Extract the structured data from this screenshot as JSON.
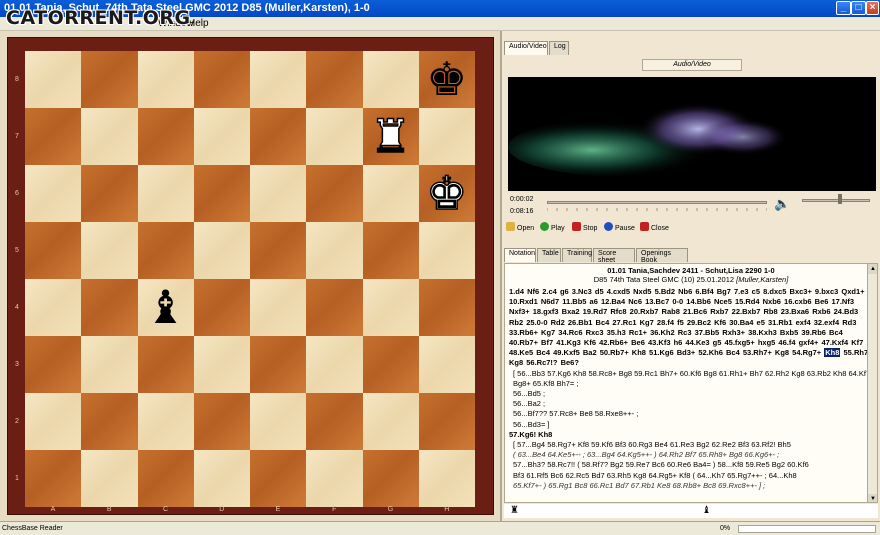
{
  "window": {
    "title": "01.01 Tania,  Schut, 74th Tata Steel GMC 2012  D85  (Muller,Karsten), 1-0",
    "logo": "CATORRENT.ORG",
    "menu": [
      "Window",
      "Help"
    ]
  },
  "board": {
    "ranks": [
      "8",
      "7",
      "6",
      "5",
      "4",
      "3",
      "2",
      "1"
    ],
    "files": [
      "A",
      "B",
      "C",
      "D",
      "E",
      "F",
      "G",
      "H"
    ],
    "pieces": [
      {
        "square": "h8",
        "glyph": "♚",
        "color": "black",
        "name": "black-king"
      },
      {
        "square": "g7",
        "glyph": "♜",
        "color": "white",
        "name": "white-rook"
      },
      {
        "square": "h6",
        "glyph": "♚",
        "color": "white",
        "name": "white-king"
      },
      {
        "square": "c4",
        "glyph": "♝",
        "color": "black",
        "name": "black-bishop"
      }
    ]
  },
  "panel_tabs": {
    "top": [
      "Audio/Video",
      "Log"
    ],
    "bottom": [
      "Notation",
      "Table",
      "Training",
      "Score sheet",
      "Openings Book"
    ]
  },
  "media": {
    "title": "Audio/Video",
    "elapsed": "0:00:02",
    "total": "0:08:16",
    "buttons": [
      "Open",
      "Play",
      "Stop",
      "Pause",
      "Close"
    ]
  },
  "game": {
    "header1": "01.01 Tania,Sachdev 2411 - Schut,Lisa 2290   1-0",
    "header2": "D85  74th Tata Steel GMC (10) 25.01.2012",
    "annotator": "[Muller,Karsten]",
    "moves_before": "1.d4  Nf6  2.c4  g6  3.Nc3  d5  4.cxd5  Nxd5  5.Bd2  Nb6  6.Bf4  Bg7  7.e3  c5  8.dxc5  Bxc3+  9.bxc3  Qxd1+  10.Rxd1  N6d7  11.Bb5  a6  12.Ba4  Nc6  13.Bc7  0-0  14.Bb6  Nce5  15.Rd4  Nxb6  16.cxb6  Be6  17.Nf3  Nxf3+  18.gxf3  Bxa2  19.Rd7  Rfc8  20.Rxb7  Rab8  21.Bc6  Rxb7  22.Bxb7  Rb8  23.Bxa6  Rxb6  24.Bd3  Rb2  25.0-0  Rd2  26.Bb1  Bc4  27.Rc1  Kg7  28.f4  f5  29.Bc2  Kf6  30.Ba4  e5  31.Rb1  exf4  32.exf4  Rd3  33.Rb6+  Kg7  34.Rc6  Rxc3  35.h3  Rc1+  36.Kh2  Rc3  37.Bb5  Rxh3+  38.Kxh3  Bxb5  39.Rb6  Bc4  40.Rb7+  Bf7  41.Kg3  Kf6  42.Rb6+  Be6  43.Kf3  h6  44.Ke3  g5  45.fxg5+  hxg5  46.f4  gxf4+  47.Kxf4  Kf7  48.Ke5  Bc4  49.Kxf5  Ba2  50.Rb7+  Kh8  51.Kg6  Bd3+  52.Kh6  Bc4  53.Rh7+  Kg8  54.Rg7+",
    "current_move": "Kh8",
    "moves_after": "55.Rh7+  Kg8  56.Rc7!?  Be6?",
    "variations": [
      {
        "text": "[ 56...Bb3  57.Kg6  Kh8  58.Rc8+  Bg8  59.Rc1  Bh7+  60.Kf6  Bg8  61.Rh1+  Bh7  62.Rh2  Kg8  63.Rb2  Kh8  64.Kf7  Bg8+  65.Kf8  Bh7= ;",
        "italic": false
      },
      {
        "text": "56...Bd5 ;",
        "italic": false
      },
      {
        "text": "56...Ba2 ;",
        "italic": false
      },
      {
        "text": "56...Bf7??  57.Rc8+  Be8  58.Rxe8++- ;",
        "italic": false
      },
      {
        "text": "56...Bd3= ]",
        "italic": false
      }
    ],
    "mainline2": "57.Kg6!  Kh8",
    "variations2": [
      {
        "text": "[ 57...Bg4  58.Rg7+  Kf8  59.Kf6  Bf3  60.Rg3  Be4  61.Re3  Bg2  62.Re2  Bf3  63.Rf2!  Bh5",
        "italic": false
      },
      {
        "text": "( 63...Be4  64.Ke5+-- ; 63...Bg4  64.Kg5++- ) 64.Rh2  Bf7  65.Rh8+  Bg8  66.Kg6+- ;",
        "italic": true
      },
      {
        "text": "57...Bh3?  58.Rc7!!  ( 58.Rf7?  Bg2  59.Re7  Bc6  60.Re6  Ba4= ) 58...Kf8  59.Re5  Bg2  60.Kf6",
        "italic": false
      },
      {
        "text": "Bf3  61.Rf5  Bc6  62.Rc5  Bd7  63.Rh5  Kg8  64.Rg5+  Kf8  ( 64...Kh7  65.Rg7++- ; 64...Kh8",
        "italic": false
      },
      {
        "text": "65.Kf7+- ) 65.Rg1  Bc8  66.Rc1  Bd7  67.Rb1  Ke8  68.Rb8+  Bc8  69.Rxc8++- ] ;",
        "italic": true
      }
    ]
  },
  "status": {
    "left": "ChessBase Reader",
    "percent": "0%"
  }
}
